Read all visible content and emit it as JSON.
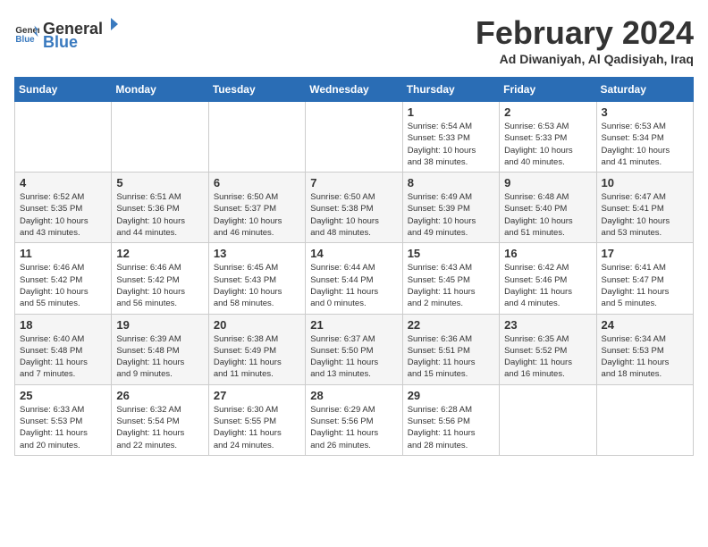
{
  "header": {
    "logo_general": "General",
    "logo_blue": "Blue",
    "month_title": "February 2024",
    "location": "Ad Diwaniyah, Al Qadisiyah, Iraq"
  },
  "calendar": {
    "days_of_week": [
      "Sunday",
      "Monday",
      "Tuesday",
      "Wednesday",
      "Thursday",
      "Friday",
      "Saturday"
    ],
    "weeks": [
      [
        {
          "num": "",
          "info": ""
        },
        {
          "num": "",
          "info": ""
        },
        {
          "num": "",
          "info": ""
        },
        {
          "num": "",
          "info": ""
        },
        {
          "num": "1",
          "info": "Sunrise: 6:54 AM\nSunset: 5:33 PM\nDaylight: 10 hours\nand 38 minutes."
        },
        {
          "num": "2",
          "info": "Sunrise: 6:53 AM\nSunset: 5:33 PM\nDaylight: 10 hours\nand 40 minutes."
        },
        {
          "num": "3",
          "info": "Sunrise: 6:53 AM\nSunset: 5:34 PM\nDaylight: 10 hours\nand 41 minutes."
        }
      ],
      [
        {
          "num": "4",
          "info": "Sunrise: 6:52 AM\nSunset: 5:35 PM\nDaylight: 10 hours\nand 43 minutes."
        },
        {
          "num": "5",
          "info": "Sunrise: 6:51 AM\nSunset: 5:36 PM\nDaylight: 10 hours\nand 44 minutes."
        },
        {
          "num": "6",
          "info": "Sunrise: 6:50 AM\nSunset: 5:37 PM\nDaylight: 10 hours\nand 46 minutes."
        },
        {
          "num": "7",
          "info": "Sunrise: 6:50 AM\nSunset: 5:38 PM\nDaylight: 10 hours\nand 48 minutes."
        },
        {
          "num": "8",
          "info": "Sunrise: 6:49 AM\nSunset: 5:39 PM\nDaylight: 10 hours\nand 49 minutes."
        },
        {
          "num": "9",
          "info": "Sunrise: 6:48 AM\nSunset: 5:40 PM\nDaylight: 10 hours\nand 51 minutes."
        },
        {
          "num": "10",
          "info": "Sunrise: 6:47 AM\nSunset: 5:41 PM\nDaylight: 10 hours\nand 53 minutes."
        }
      ],
      [
        {
          "num": "11",
          "info": "Sunrise: 6:46 AM\nSunset: 5:42 PM\nDaylight: 10 hours\nand 55 minutes."
        },
        {
          "num": "12",
          "info": "Sunrise: 6:46 AM\nSunset: 5:42 PM\nDaylight: 10 hours\nand 56 minutes."
        },
        {
          "num": "13",
          "info": "Sunrise: 6:45 AM\nSunset: 5:43 PM\nDaylight: 10 hours\nand 58 minutes."
        },
        {
          "num": "14",
          "info": "Sunrise: 6:44 AM\nSunset: 5:44 PM\nDaylight: 11 hours\nand 0 minutes."
        },
        {
          "num": "15",
          "info": "Sunrise: 6:43 AM\nSunset: 5:45 PM\nDaylight: 11 hours\nand 2 minutes."
        },
        {
          "num": "16",
          "info": "Sunrise: 6:42 AM\nSunset: 5:46 PM\nDaylight: 11 hours\nand 4 minutes."
        },
        {
          "num": "17",
          "info": "Sunrise: 6:41 AM\nSunset: 5:47 PM\nDaylight: 11 hours\nand 5 minutes."
        }
      ],
      [
        {
          "num": "18",
          "info": "Sunrise: 6:40 AM\nSunset: 5:48 PM\nDaylight: 11 hours\nand 7 minutes."
        },
        {
          "num": "19",
          "info": "Sunrise: 6:39 AM\nSunset: 5:48 PM\nDaylight: 11 hours\nand 9 minutes."
        },
        {
          "num": "20",
          "info": "Sunrise: 6:38 AM\nSunset: 5:49 PM\nDaylight: 11 hours\nand 11 minutes."
        },
        {
          "num": "21",
          "info": "Sunrise: 6:37 AM\nSunset: 5:50 PM\nDaylight: 11 hours\nand 13 minutes."
        },
        {
          "num": "22",
          "info": "Sunrise: 6:36 AM\nSunset: 5:51 PM\nDaylight: 11 hours\nand 15 minutes."
        },
        {
          "num": "23",
          "info": "Sunrise: 6:35 AM\nSunset: 5:52 PM\nDaylight: 11 hours\nand 16 minutes."
        },
        {
          "num": "24",
          "info": "Sunrise: 6:34 AM\nSunset: 5:53 PM\nDaylight: 11 hours\nand 18 minutes."
        }
      ],
      [
        {
          "num": "25",
          "info": "Sunrise: 6:33 AM\nSunset: 5:53 PM\nDaylight: 11 hours\nand 20 minutes."
        },
        {
          "num": "26",
          "info": "Sunrise: 6:32 AM\nSunset: 5:54 PM\nDaylight: 11 hours\nand 22 minutes."
        },
        {
          "num": "27",
          "info": "Sunrise: 6:30 AM\nSunset: 5:55 PM\nDaylight: 11 hours\nand 24 minutes."
        },
        {
          "num": "28",
          "info": "Sunrise: 6:29 AM\nSunset: 5:56 PM\nDaylight: 11 hours\nand 26 minutes."
        },
        {
          "num": "29",
          "info": "Sunrise: 6:28 AM\nSunset: 5:56 PM\nDaylight: 11 hours\nand 28 minutes."
        },
        {
          "num": "",
          "info": ""
        },
        {
          "num": "",
          "info": ""
        }
      ]
    ]
  }
}
